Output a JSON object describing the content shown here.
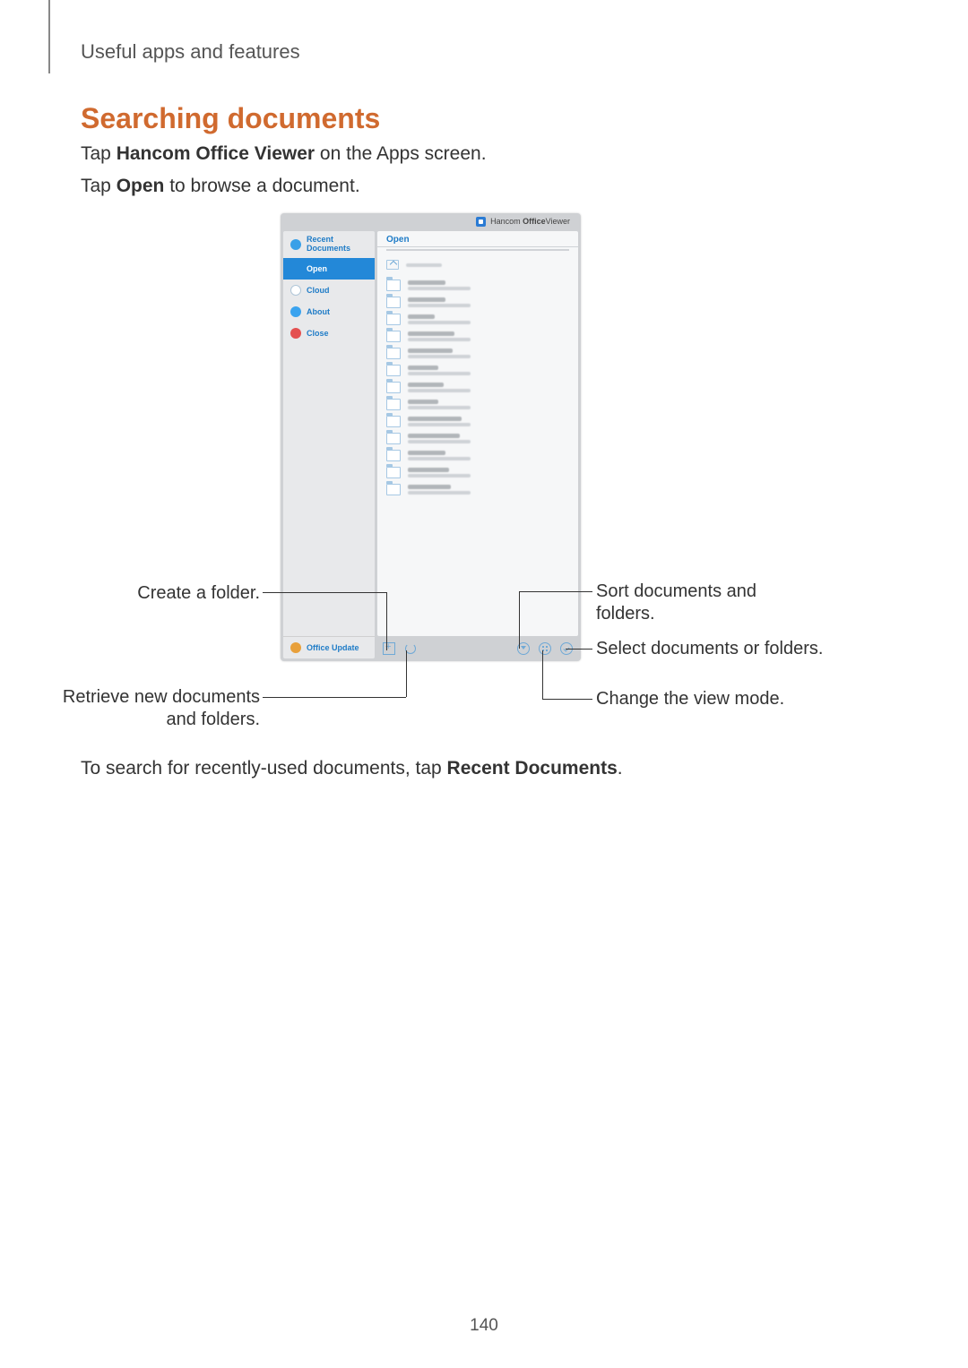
{
  "header": {
    "breadcrumb": "Useful apps and features"
  },
  "section": {
    "title": "Searching documents"
  },
  "paragraphs": {
    "p1_pre": "Tap ",
    "p1_bold": "Hancom Office Viewer",
    "p1_post": " on the Apps screen.",
    "p2_pre": "Tap ",
    "p2_bold": "Open",
    "p2_post": " to browse a document.",
    "p3_pre": "To search for recently-used documents, tap ",
    "p3_bold": "Recent Documents",
    "p3_post": "."
  },
  "screenshot": {
    "title_prefix": "Hancom ",
    "title_bold": "Office",
    "title_suffix": "Viewer",
    "sidebar": {
      "recent": "Recent Documents",
      "open": "Open",
      "cloud": "Cloud",
      "about": "About",
      "close": "Close",
      "update": "Office Update"
    },
    "main": {
      "panel_title": "Open"
    }
  },
  "callouts": {
    "create_folder": "Create a folder.",
    "retrieve": "Retrieve new documents and folders.",
    "sort": "Sort documents and folders.",
    "select": "Select documents or folders.",
    "view": "Change the view mode."
  },
  "page_number": "140"
}
